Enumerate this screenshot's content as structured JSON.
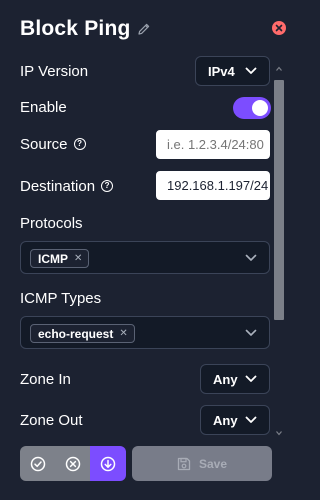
{
  "header": {
    "title": "Block Ping"
  },
  "fields": {
    "ip_version": {
      "label": "IP Version",
      "value": "IPv4"
    },
    "enable": {
      "label": "Enable",
      "on": true
    },
    "source": {
      "label": "Source",
      "placeholder": "i.e. 1.2.3.4/24:80",
      "value": ""
    },
    "destination": {
      "label": "Destination",
      "value": "192.168.1.197/24"
    },
    "protocols": {
      "label": "Protocols",
      "chips": [
        "ICMP"
      ]
    },
    "icmp_types": {
      "label": "ICMP Types",
      "chips": [
        "echo-request"
      ]
    },
    "zone_in": {
      "label": "Zone In",
      "value": "Any"
    },
    "zone_out": {
      "label": "Zone Out",
      "value": "Any"
    }
  },
  "footer": {
    "save_label": "Save"
  },
  "colors": {
    "accent": "#7c4dff",
    "close": "#ff6b6b",
    "background": "#1c2231"
  }
}
